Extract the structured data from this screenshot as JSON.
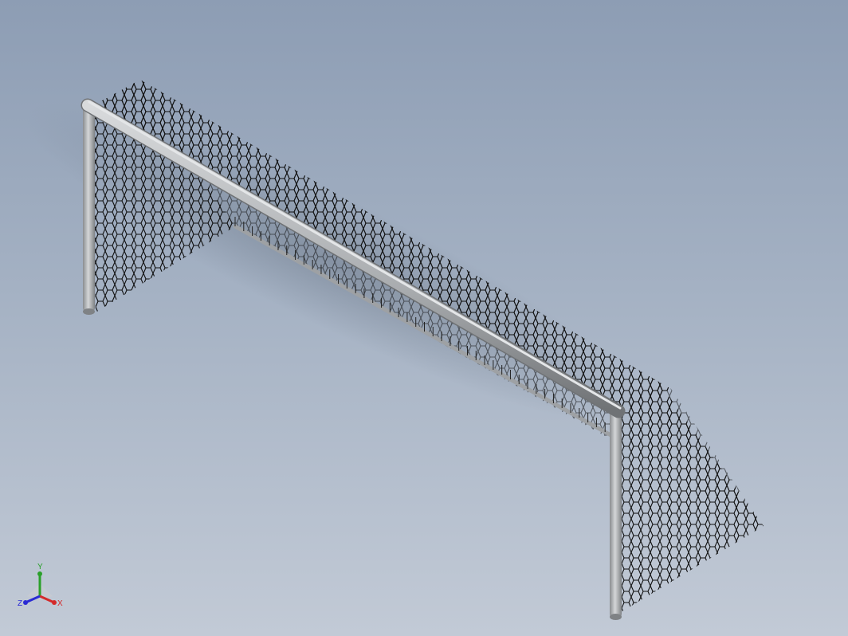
{
  "viewport": {
    "background_top": "#8d9db4",
    "background_bottom": "#c2cad6",
    "model": "soccer-goal",
    "frame_color": "#a9acaf",
    "net_color": "#101010"
  },
  "triad": {
    "x_label": "X",
    "y_label": "Y",
    "z_label": "Z",
    "x_color": "#d42a2a",
    "y_color": "#2aa02a",
    "z_color": "#2a2ad4"
  }
}
